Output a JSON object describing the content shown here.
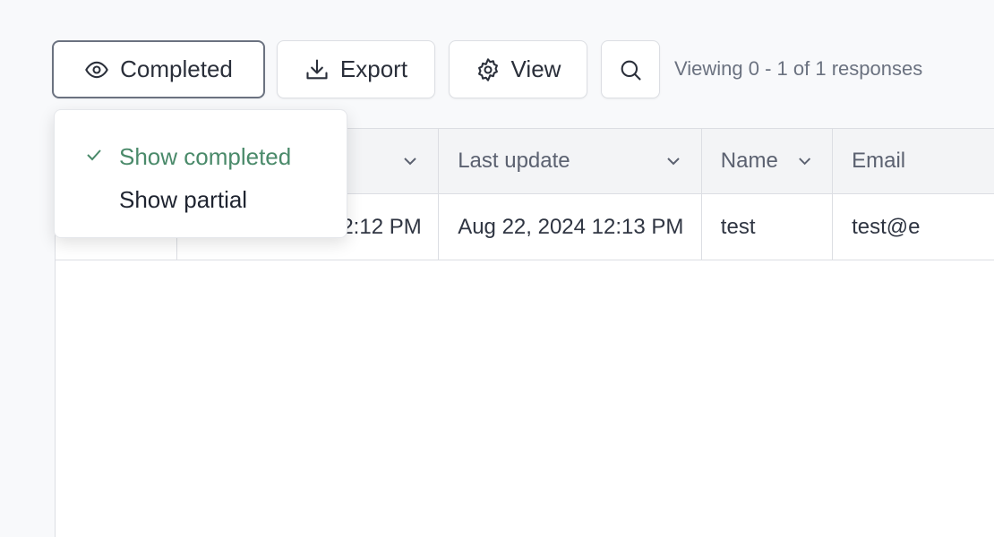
{
  "toolbar": {
    "filter_label": "Completed",
    "export_label": "Export",
    "view_label": "View",
    "viewing_text": "Viewing 0 - 1 of 1 responses"
  },
  "table": {
    "headers": [
      "",
      "",
      "Last update",
      "Name",
      "Email"
    ],
    "rows": [
      [
        "",
        "Aug 22, 2024 12:12 PM",
        "Aug 22, 2024 12:13 PM",
        "test",
        "test@e"
      ]
    ]
  },
  "filter_menu": {
    "items": [
      {
        "label": "Show completed",
        "selected": true
      },
      {
        "label": "Show partial",
        "selected": false
      }
    ]
  },
  "colors": {
    "selected": "#4a8a6a"
  }
}
